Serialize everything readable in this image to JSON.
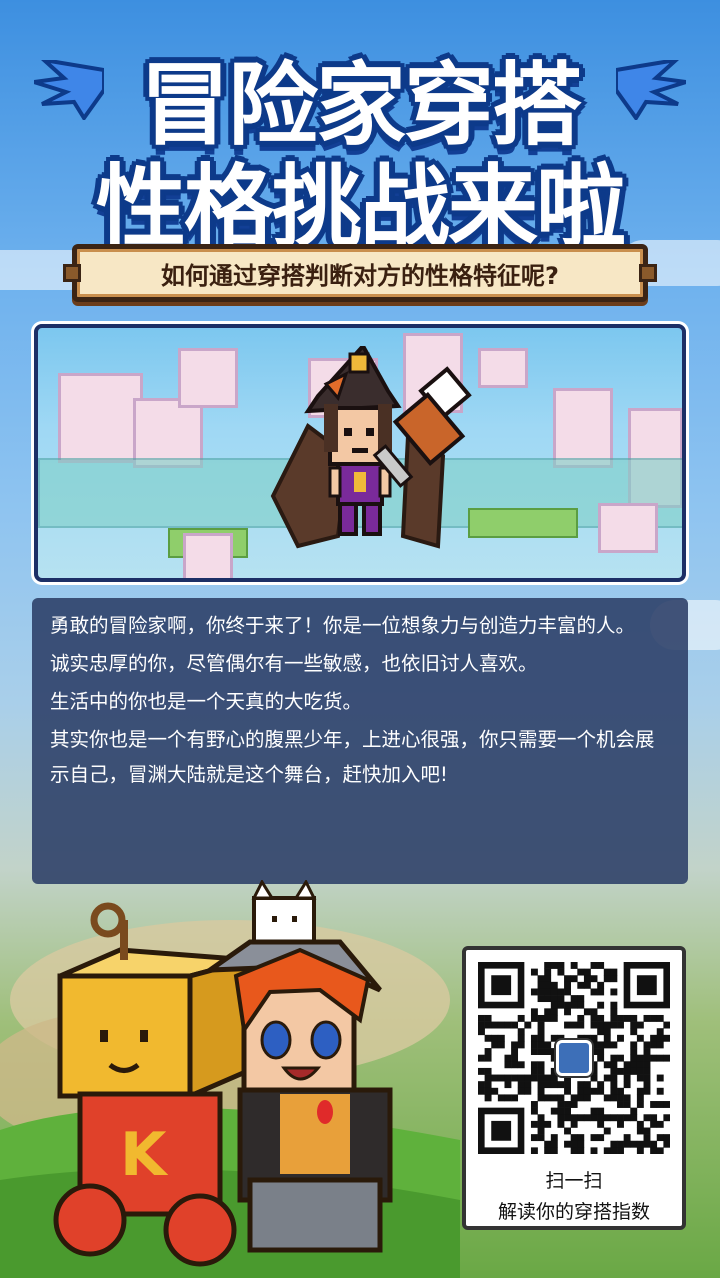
{
  "title": {
    "line1": "冒险家穿搭",
    "line2": "性格挑战来啦"
  },
  "subtitle": "如何通过穿搭判断对方的性格特征呢?",
  "scene": {
    "icon": "adventurer-avatar"
  },
  "description": {
    "paragraphs": [
      "勇敢的冒险家啊，你终于来了！你是一位想象力与创造力丰富的人。",
      "诚实忠厚的你，尽管偶尔有一些敏感，也依旧讨人喜欢。",
      "生活中的你也是一个天真的大吃货。",
      "其实你也是一个有野心的腹黑少年，上进心很强，你只需要一个机会展示自己，冒渊大陆就是这个舞台，赶快加入吧!"
    ]
  },
  "qr": {
    "caption_line1": "扫一扫",
    "caption_line2": "解读你的穿搭指数",
    "icon": "qr-code"
  },
  "colors": {
    "title_outline": "#0d3a8a",
    "banner_bg": "#f7e7c5",
    "panel_bg": "#2b3d66"
  }
}
